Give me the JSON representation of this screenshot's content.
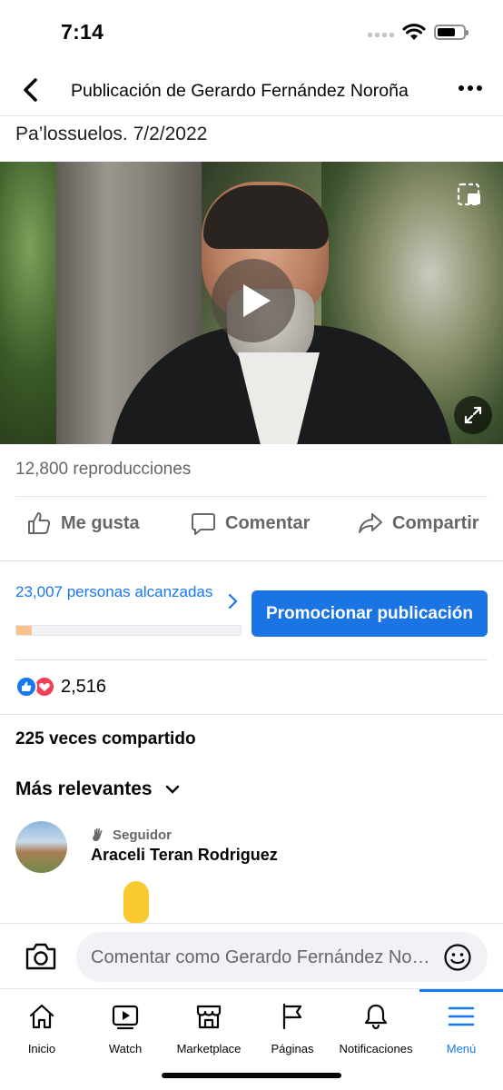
{
  "status_bar": {
    "time": "7:14"
  },
  "header": {
    "title": "Publicación de Gerardo Fernández Noroña"
  },
  "post": {
    "text": "Pa’lossuelos. 7/2/2022",
    "views": "12,800 reproducciones"
  },
  "actions": {
    "like": "Me gusta",
    "comment": "Comentar",
    "share": "Compartir"
  },
  "insights": {
    "reach": "23,007 personas alcanzadas",
    "reach_progress": 0.07,
    "promote": "Promocionar publicación"
  },
  "reactions": {
    "count": "2,516"
  },
  "shares": "225 veces compartido",
  "comments": {
    "sort_label": "Más relevantes",
    "items": [
      {
        "badge": "Seguidor",
        "author": "Araceli Teran Rodriguez"
      }
    ]
  },
  "composer": {
    "placeholder": "Comentar como Gerardo Fernández Noroña"
  },
  "tabbar": {
    "items": [
      {
        "label": "Inicio"
      },
      {
        "label": "Watch"
      },
      {
        "label": "Marketplace"
      },
      {
        "label": "Páginas"
      },
      {
        "label": "Notificaciones"
      },
      {
        "label": "Menú"
      }
    ],
    "active": "Menú"
  },
  "colors": {
    "accent": "#1877f2",
    "promote": "#1b74e4",
    "reach_fill": "#f7c28b"
  }
}
